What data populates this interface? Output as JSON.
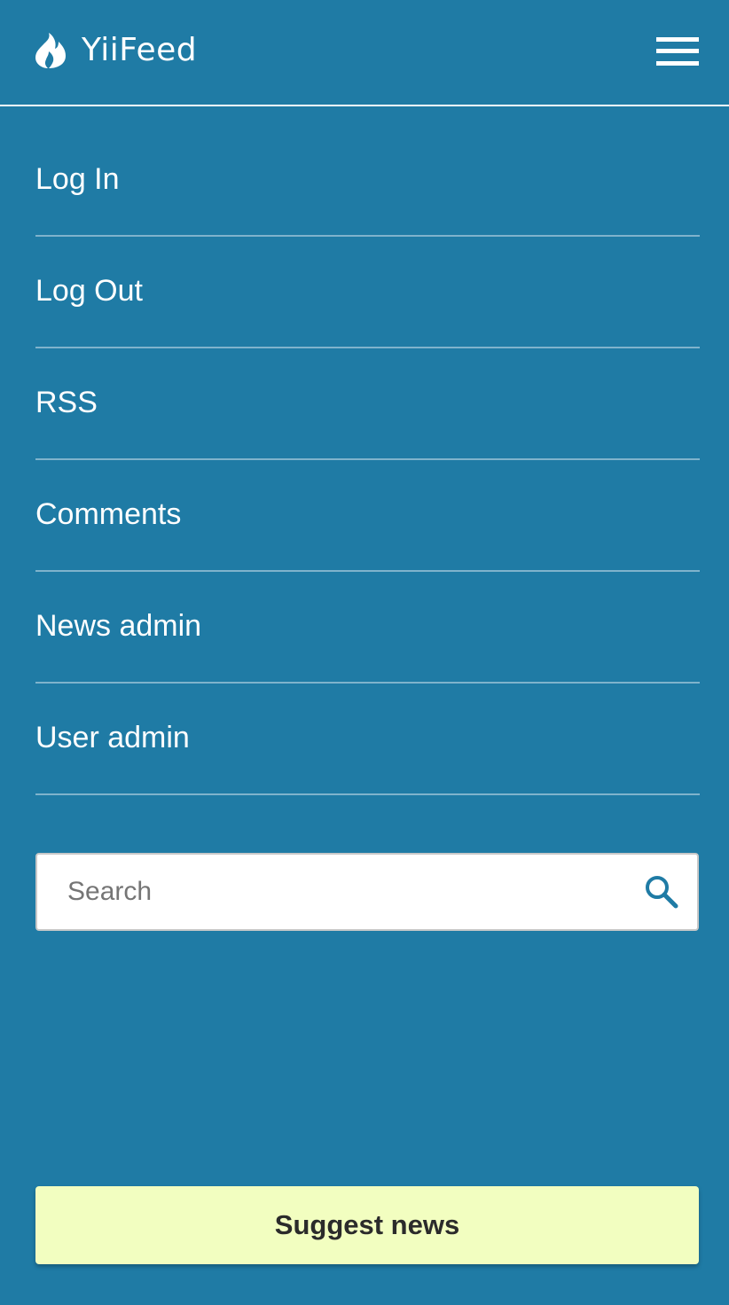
{
  "header": {
    "brand_name": "YiiFeed",
    "brand_icon": "flame-icon",
    "menu_icon": "hamburger-menu-icon"
  },
  "nav": {
    "items": [
      {
        "label": "Log In"
      },
      {
        "label": "Log Out"
      },
      {
        "label": "RSS"
      },
      {
        "label": "Comments"
      },
      {
        "label": "News admin"
      },
      {
        "label": "User admin"
      }
    ]
  },
  "search": {
    "placeholder": "Search",
    "value": "",
    "icon": "search-icon"
  },
  "suggest": {
    "label": "Suggest news"
  },
  "colors": {
    "background": "#1f7ba5",
    "nav_divider": "#7fb3cc",
    "suggest_button": "#f2fec0",
    "search_icon": "#1f7ba5"
  }
}
